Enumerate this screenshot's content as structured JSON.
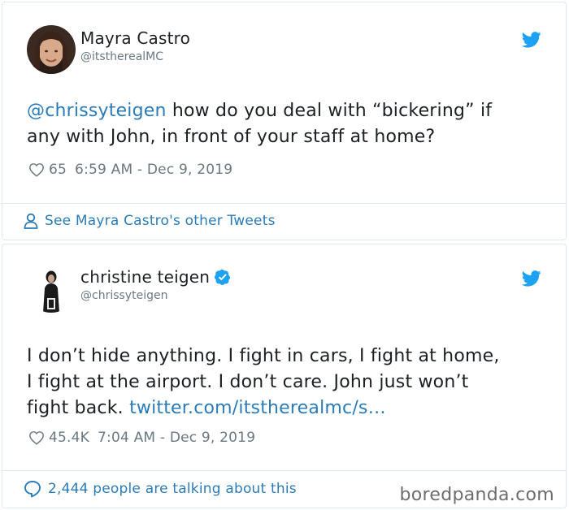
{
  "tweets": [
    {
      "display_name": "Mayra Castro",
      "handle": "@itstherealMC",
      "text_prefix": "@chrissyteigen",
      "text_line1_rest": " how do you deal with “bickering” if",
      "text_line2": "any with John, in front of your staff at home?",
      "likes": "65",
      "timestamp": "6:59 AM - Dec 9, 2019",
      "footer": "See Mayra Castro's other Tweets"
    },
    {
      "display_name": "christine teigen",
      "verified": true,
      "handle": "@chrissyteigen",
      "text_line1": "I don’t hide anything. I fight in cars, I fight at home,",
      "text_line2": "I fight at the airport. I don’t care. John just won’t",
      "text_line3_prefix": "fight back. ",
      "text_link": "twitter.com/itstherealmc/s…",
      "likes": "45.4K",
      "timestamp": "7:04 AM - Dec 9, 2019",
      "footer": "2,444 people are talking about this",
      "watermark": "boredpanda.com"
    }
  ],
  "icons": {
    "bird": "twitter-bird-icon",
    "heart": "heart-outline-icon",
    "person": "person-icon",
    "speech": "speech-bubble-icon",
    "verified": "verified-badge-icon"
  },
  "colors": {
    "brand": "#1da1f2",
    "link": "#2b7bb9",
    "muted": "#697882",
    "text": "#1c2022",
    "border": "#e1e8ed"
  }
}
